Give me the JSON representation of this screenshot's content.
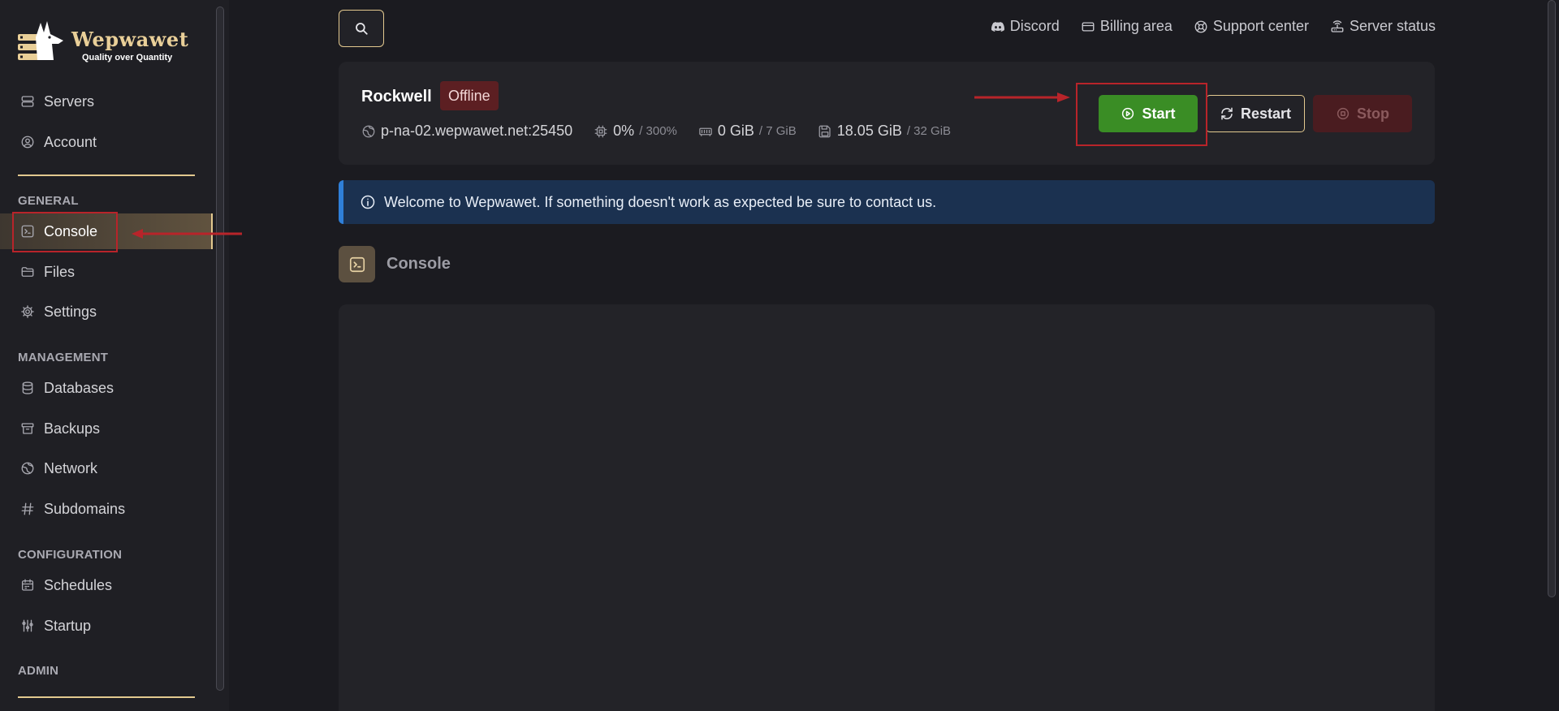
{
  "brand": {
    "name": "Wepwawet",
    "tagline": "Quality over Quantity"
  },
  "sidebar": {
    "top_items": [
      {
        "label": "Servers",
        "icon": "server-icon"
      },
      {
        "label": "Account",
        "icon": "user-circle-icon"
      }
    ],
    "sections": [
      {
        "label": "GENERAL",
        "items": [
          {
            "label": "Console",
            "icon": "terminal-icon",
            "active": true
          },
          {
            "label": "Files",
            "icon": "folder-icon"
          },
          {
            "label": "Settings",
            "icon": "gear-icon"
          }
        ]
      },
      {
        "label": "MANAGEMENT",
        "items": [
          {
            "label": "Databases",
            "icon": "database-icon"
          },
          {
            "label": "Backups",
            "icon": "archive-icon"
          },
          {
            "label": "Network",
            "icon": "globe-icon"
          },
          {
            "label": "Subdomains",
            "icon": "hash-icon"
          }
        ]
      },
      {
        "label": "CONFIGURATION",
        "items": [
          {
            "label": "Schedules",
            "icon": "calendar-icon"
          },
          {
            "label": "Startup",
            "icon": "sliders-icon"
          }
        ]
      },
      {
        "label": "ADMIN",
        "items": []
      }
    ]
  },
  "topnav": {
    "links": [
      {
        "label": "Discord",
        "icon": "discord-icon"
      },
      {
        "label": "Billing area",
        "icon": "credit-card-icon"
      },
      {
        "label": "Support center",
        "icon": "lifebuoy-icon"
      },
      {
        "label": "Server status",
        "icon": "router-icon"
      }
    ]
  },
  "server": {
    "name": "Rockwell",
    "status": "Offline",
    "address": "p-na-02.wepwawet.net:25450",
    "cpu": {
      "value": "0%",
      "limit": "/ 300%"
    },
    "memory": {
      "value": "0 GiB",
      "limit": "/ 7 GiB"
    },
    "disk": {
      "value": "18.05 GiB",
      "limit": "/ 32 GiB"
    }
  },
  "power": {
    "start": "Start",
    "restart": "Restart",
    "stop": "Stop"
  },
  "alert": {
    "message": "Welcome to Wepwawet. If something doesn't work as expected be sure to contact us."
  },
  "console": {
    "title": "Console"
  },
  "colors": {
    "accent_gold": "#e3c98f",
    "start_green": "#3a8d25",
    "offline_red": "#5c1f22",
    "alert_blue": "#1b3150",
    "annotation_red": "#b8242a"
  }
}
